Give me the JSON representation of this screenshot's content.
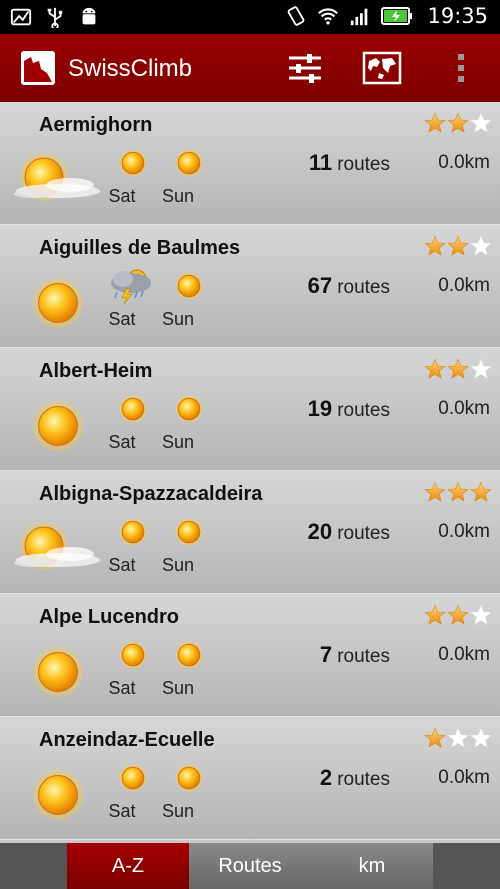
{
  "status_bar": {
    "time": "19:35",
    "icons": [
      "image-icon",
      "usb-icon",
      "android-debug-icon",
      "rotate-icon",
      "wifi-icon",
      "signal-icon",
      "battery-charging-icon"
    ]
  },
  "action_bar": {
    "title": "SwissClimb",
    "icons": [
      "app-logo-icon",
      "filter-sliders-icon",
      "map-icon",
      "overflow-menu-icon"
    ],
    "brand_color": "#8b0000"
  },
  "list": {
    "day_labels": {
      "sat": "Sat",
      "sun": "Sun"
    },
    "route_unit": "routes",
    "items": [
      {
        "name": "Aermighorn",
        "rating": 2,
        "routes": "11",
        "distance": "0.0km",
        "today": "sun-cloud-icon",
        "sat": "sun-icon",
        "sun": "sun-icon"
      },
      {
        "name": "Aiguilles de Baulmes",
        "rating": 2,
        "routes": "67",
        "distance": "0.0km",
        "today": "sun-icon",
        "sat": "thunderstorm-icon",
        "sun": "sun-icon"
      },
      {
        "name": "Albert-Heim",
        "rating": 2,
        "routes": "19",
        "distance": "0.0km",
        "today": "sun-icon",
        "sat": "sun-icon",
        "sun": "sun-icon"
      },
      {
        "name": "Albigna-Spazzacaldeira",
        "rating": 3,
        "routes": "20",
        "distance": "0.0km",
        "today": "sun-cloud-icon",
        "sat": "sun-icon",
        "sun": "sun-icon"
      },
      {
        "name": "Alpe Lucendro",
        "rating": 2,
        "routes": "7",
        "distance": "0.0km",
        "today": "sun-icon",
        "sat": "sun-icon",
        "sun": "sun-icon"
      },
      {
        "name": "Anzeindaz-Ecuelle",
        "rating": 1,
        "routes": "2",
        "distance": "0.0km",
        "today": "sun-icon",
        "sat": "sun-icon",
        "sun": "sun-icon"
      }
    ]
  },
  "tabs": [
    {
      "label": "A-Z",
      "active": true
    },
    {
      "label": "Routes",
      "active": false
    },
    {
      "label": "km",
      "active": false
    }
  ]
}
